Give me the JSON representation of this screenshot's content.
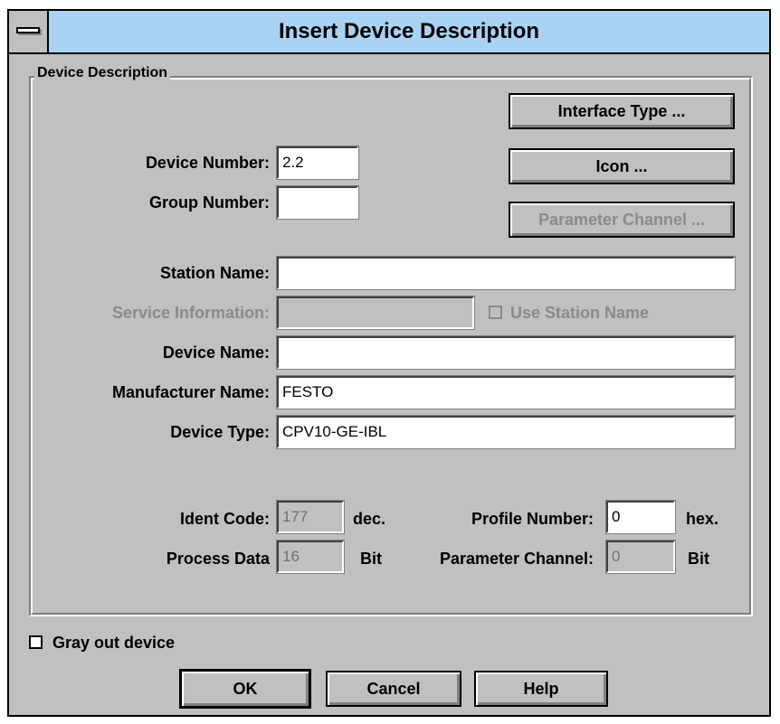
{
  "window": {
    "title": "Insert Device Description"
  },
  "group": {
    "title": "Device Description"
  },
  "buttons": {
    "interface_type": "Interface Type ...",
    "icon": "Icon ...",
    "parameter_channel": "Parameter Channel ...",
    "ok": "OK",
    "cancel": "Cancel",
    "help": "Help"
  },
  "fields": {
    "device_number": {
      "label": "Device Number:",
      "value": "2.2"
    },
    "group_number": {
      "label": "Group Number:",
      "value": ""
    },
    "station_name": {
      "label": "Station Name:",
      "value": ""
    },
    "service_information": {
      "label": "Service Information:",
      "value": ""
    },
    "use_station_name": {
      "label": "Use Station Name"
    },
    "device_name": {
      "label": "Device Name:",
      "value": ""
    },
    "manufacturer_name": {
      "label": "Manufacturer Name:",
      "value": "FESTO"
    },
    "device_type": {
      "label": "Device Type:",
      "value": "CPV10-GE-IBL"
    },
    "ident_code": {
      "label": "Ident Code:",
      "value": "177",
      "unit": "dec."
    },
    "process_data": {
      "label": "Process Data",
      "value": "16",
      "unit": "Bit"
    },
    "profile_number": {
      "label": "Profile Number:",
      "value": "0",
      "unit": "hex."
    },
    "parameter_channel": {
      "label": "Parameter Channel:",
      "value": "0",
      "unit": "Bit"
    }
  },
  "gray_out_device": {
    "label": "Gray out device",
    "checked": false
  }
}
